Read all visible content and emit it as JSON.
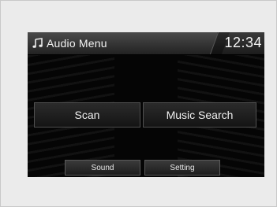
{
  "header": {
    "icon": "music-note-icon",
    "title": "Audio Menu",
    "clock": "12:34"
  },
  "main_buttons": {
    "scan": "Scan",
    "music_search": "Music Search"
  },
  "bottom_tabs": {
    "sound": "Sound",
    "setting": "Setting"
  },
  "colors": {
    "screen_bg": "#0a0a0a",
    "text": "#f2f2f2",
    "frame_bg": "#ebebeb"
  }
}
